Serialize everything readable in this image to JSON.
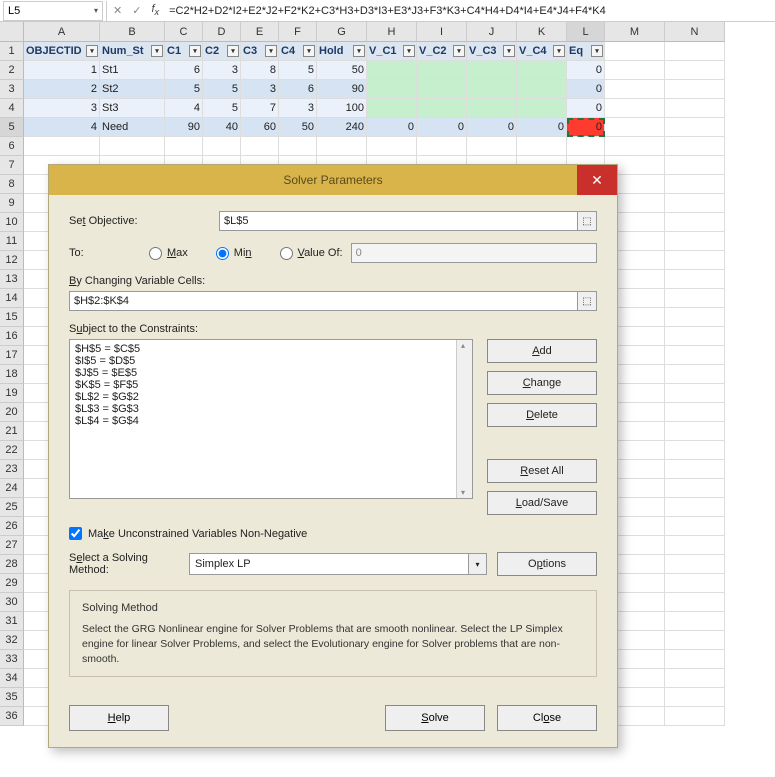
{
  "name_box": "L5",
  "formula": "=C2*H2+D2*I2+E2*J2+F2*K2+C3*H3+D3*I3+E3*J3+F3*K3+C4*H4+D4*I4+E4*J4+F4*K4",
  "columns": [
    "A",
    "B",
    "C",
    "D",
    "E",
    "F",
    "G",
    "H",
    "I",
    "J",
    "K",
    "L",
    "M",
    "N"
  ],
  "row_numbers": [
    "1",
    "2",
    "3",
    "4",
    "5",
    "6",
    "7",
    "8",
    "9",
    "10",
    "11",
    "12",
    "13",
    "14",
    "15",
    "16",
    "17",
    "18",
    "19",
    "20",
    "21",
    "22",
    "23",
    "24",
    "25",
    "26",
    "27",
    "28",
    "29",
    "30",
    "31",
    "32",
    "33",
    "34",
    "35",
    "36"
  ],
  "headers": [
    "OBJECTID",
    "Num_St",
    "C1",
    "C2",
    "C3",
    "C4",
    "Hold",
    "V_C1",
    "V_C2",
    "V_C3",
    "V_C4",
    "Eq"
  ],
  "data": [
    {
      "oid": "1",
      "num": "St1",
      "c1": "6",
      "c2": "3",
      "c3": "8",
      "c4": "5",
      "hold": "50",
      "v1": "",
      "v2": "",
      "v3": "",
      "v4": "",
      "eq": "0"
    },
    {
      "oid": "2",
      "num": "St2",
      "c1": "5",
      "c2": "5",
      "c3": "3",
      "c4": "6",
      "hold": "90",
      "v1": "",
      "v2": "",
      "v3": "",
      "v4": "",
      "eq": "0"
    },
    {
      "oid": "3",
      "num": "St3",
      "c1": "4",
      "c2": "5",
      "c3": "7",
      "c4": "3",
      "hold": "100",
      "v1": "",
      "v2": "",
      "v3": "",
      "v4": "",
      "eq": "0"
    },
    {
      "oid": "4",
      "num": "Need",
      "c1": "90",
      "c2": "40",
      "c3": "60",
      "c4": "50",
      "hold": "240",
      "v1": "0",
      "v2": "0",
      "v3": "0",
      "v4": "0",
      "eq": "0"
    }
  ],
  "dialog": {
    "title": "Solver Parameters",
    "set_obj_label": "Set Objective:",
    "set_obj_value": "$L$5",
    "to_label": "To:",
    "max_label": "Max",
    "min_label": "Min",
    "valof_label": "Value Of:",
    "valof_value": "0",
    "bychg_label": "By Changing Variable Cells:",
    "bychg_value": "$H$2:$K$4",
    "constraints_label": "Subject to the Constraints:",
    "constraints": [
      "$H$5 = $C$5",
      "$I$5 = $D$5",
      "$J$5 = $E$5",
      "$K$5 = $F$5",
      "$L$2 = $G$2",
      "$L$3 = $G$3",
      "$L$4 = $G$4"
    ],
    "btn_add": "Add",
    "btn_change": "Change",
    "btn_delete": "Delete",
    "btn_reset": "Reset All",
    "btn_loadsave": "Load/Save",
    "chk_label": "Make Unconstrained Variables Non-Negative",
    "method_label": "Select a Solving Method:",
    "method_value": "Simplex LP",
    "btn_options": "Options",
    "desc_title": "Solving Method",
    "desc_body": "Select the GRG Nonlinear engine for Solver Problems that are smooth nonlinear. Select the LP Simplex engine for linear Solver Problems, and select the Evolutionary engine for Solver problems that are non-smooth.",
    "btn_help": "Help",
    "btn_solve": "Solve",
    "btn_close": "Close"
  }
}
